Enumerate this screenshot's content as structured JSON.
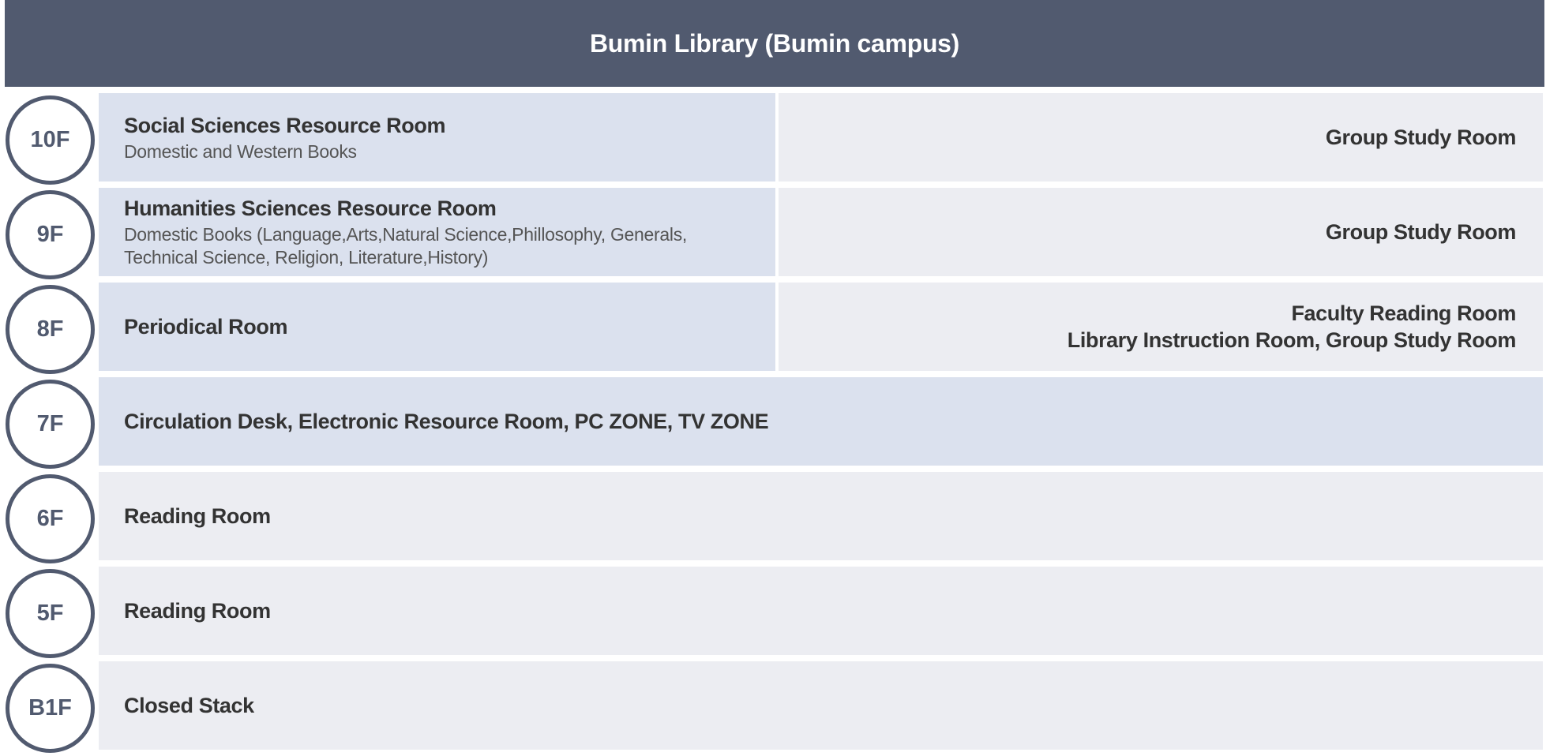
{
  "title": "Bumin Library (Bumin campus)",
  "floors": {
    "f10": {
      "label": "10F",
      "left_title": "Social Sciences Resource Room",
      "left_desc": "Domestic and Western Books",
      "right_lines": [
        "Group Study Room"
      ]
    },
    "f9": {
      "label": "9F",
      "left_title": "Humanities Sciences Resource Room",
      "left_desc_line1": "Domestic Books (Language,Arts,Natural Science,Phillosophy, Generals,",
      "left_desc_line2": "Technical Science, Religion, Literature,History)",
      "right_lines": [
        "Group Study Room"
      ]
    },
    "f8": {
      "label": "8F",
      "left_title": "Periodical Room",
      "right_lines": [
        "Faculty Reading Room",
        "Library Instruction Room, Group Study Room"
      ]
    },
    "f7": {
      "label": "7F",
      "title": "Circulation Desk, Electronic Resource Room, PC ZONE, TV ZONE"
    },
    "f6": {
      "label": "6F",
      "title": "Reading Room"
    },
    "f5": {
      "label": "5F",
      "title": "Reading Room"
    },
    "b1": {
      "label": "B1F",
      "title": "Closed Stack"
    }
  },
  "colors": {
    "header_bg": "#515a6f",
    "badge_border": "#515a6f",
    "panel_blue": "#dbe1ee",
    "panel_grey": "#ecedf2",
    "text": "#333333"
  }
}
